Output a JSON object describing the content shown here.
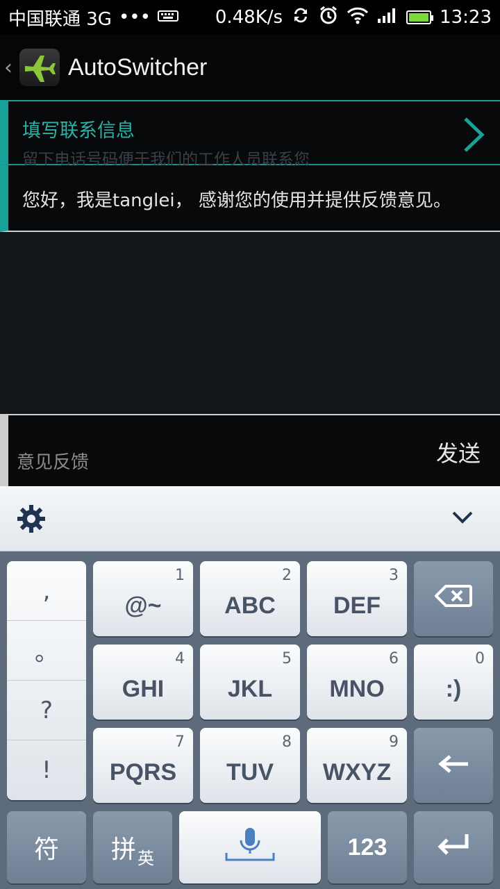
{
  "status_bar": {
    "carrier": "中国联通 3G",
    "dots": "•••",
    "speed": "0.48K/s",
    "time": "13:23"
  },
  "action_bar": {
    "back": "‹",
    "title": "AutoSwitcher"
  },
  "contact": {
    "title": "填写联系信息",
    "subtitle": "留下电话号码便于我们的工作人员联系您"
  },
  "message": {
    "text": "您好，我是tanglei， 感谢您的使用并提供反馈意见。"
  },
  "feedback": {
    "placeholder": "意见反馈",
    "send_label": "发送"
  },
  "keyboard": {
    "punct": [
      ",",
      "。",
      "?",
      "!"
    ],
    "keys": [
      {
        "num": "1",
        "label": "@~"
      },
      {
        "num": "2",
        "label": "ABC"
      },
      {
        "num": "3",
        "label": "DEF"
      },
      {
        "num": "4",
        "label": "GHI"
      },
      {
        "num": "5",
        "label": "JKL"
      },
      {
        "num": "6",
        "label": "MNO"
      },
      {
        "num": "0",
        "label": ":)"
      },
      {
        "num": "7",
        "label": "PQRS"
      },
      {
        "num": "8",
        "label": "TUV"
      },
      {
        "num": "9",
        "label": "WXYZ"
      }
    ],
    "fu_label": "符",
    "pin_label": "拼",
    "ying_label": "英",
    "num_label": "123"
  },
  "colors": {
    "accent": "#17a39a",
    "battery": "#7bd83a"
  }
}
